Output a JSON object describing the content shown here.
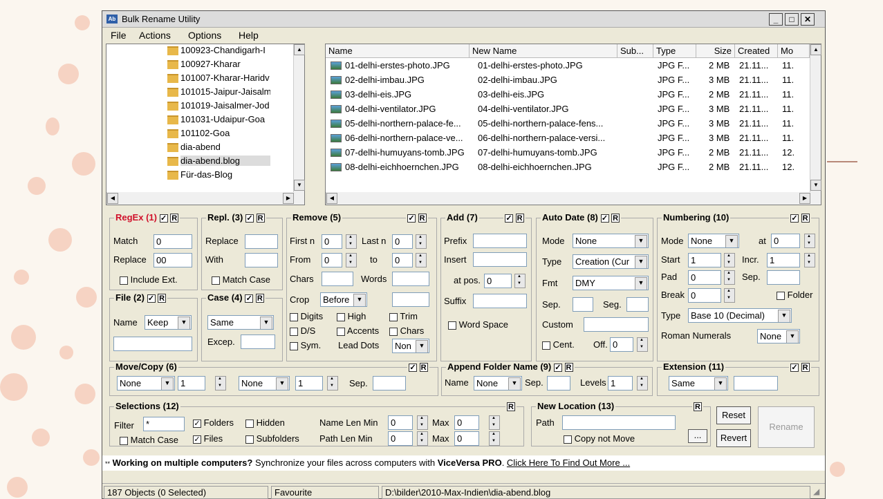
{
  "window": {
    "title": "Bulk Rename Utility",
    "app_icon_text": "Ab"
  },
  "menu": [
    "File",
    "Actions",
    "Options",
    "Help"
  ],
  "tree": [
    "100923-Chandigarh-I",
    "100927-Kharar",
    "101007-Kharar-Haridv",
    "101015-Jaipur-Jaisalm",
    "101019-Jaisalmer-Jod",
    "101031-Udaipur-Goa",
    "101102-Goa",
    "dia-abend",
    "dia-abend.blog",
    "Für-das-Blog"
  ],
  "columns": [
    "Name",
    "New Name",
    "Sub...",
    "Type",
    "Size",
    "Created",
    "Mo"
  ],
  "files": [
    {
      "name": "01-delhi-erstes-photo.JPG",
      "new": "01-delhi-erstes-photo.JPG",
      "type": "JPG F...",
      "size": "2 MB",
      "created": "21.11...",
      "mod": "11."
    },
    {
      "name": "02-delhi-imbau.JPG",
      "new": "02-delhi-imbau.JPG",
      "type": "JPG F...",
      "size": "3 MB",
      "created": "21.11...",
      "mod": "11."
    },
    {
      "name": "03-delhi-eis.JPG",
      "new": "03-delhi-eis.JPG",
      "type": "JPG F...",
      "size": "2 MB",
      "created": "21.11...",
      "mod": "11."
    },
    {
      "name": "04-delhi-ventilator.JPG",
      "new": "04-delhi-ventilator.JPG",
      "type": "JPG F...",
      "size": "3 MB",
      "created": "21.11...",
      "mod": "11."
    },
    {
      "name": "05-delhi-northern-palace-fe...",
      "new": "05-delhi-northern-palace-fens...",
      "type": "JPG F...",
      "size": "3 MB",
      "created": "21.11...",
      "mod": "11."
    },
    {
      "name": "06-delhi-northern-palace-ve...",
      "new": "06-delhi-northern-palace-versi...",
      "type": "JPG F...",
      "size": "3 MB",
      "created": "21.11...",
      "mod": "11."
    },
    {
      "name": "07-delhi-humuyans-tomb.JPG",
      "new": "07-delhi-humuyans-tomb.JPG",
      "type": "JPG F...",
      "size": "2 MB",
      "created": "21.11...",
      "mod": "12."
    },
    {
      "name": "08-delhi-eichhoernchen.JPG",
      "new": "08-delhi-eichhoernchen.JPG",
      "type": "JPG F...",
      "size": "2 MB",
      "created": "21.11...",
      "mod": "12."
    }
  ],
  "regex": {
    "title": "RegEx (1)",
    "r": "R",
    "match_label": "Match",
    "match": "0",
    "replace_label": "Replace",
    "replace": "00",
    "include_ext": "Include Ext."
  },
  "repl": {
    "title": "Repl. (3)",
    "r": "R",
    "replace_label": "Replace",
    "with_label": "With",
    "match_case": "Match Case"
  },
  "file": {
    "title": "File (2)",
    "r": "R",
    "name_label": "Name",
    "name_value": "Keep"
  },
  "case": {
    "title": "Case (4)",
    "r": "R",
    "value": "Same",
    "excep": "Excep."
  },
  "remove": {
    "title": "Remove (5)",
    "r": "R",
    "first_n": "First n",
    "first_val": "0",
    "last_n": "Last n",
    "last_val": "0",
    "from": "From",
    "from_val": "0",
    "to": "to",
    "to_val": "0",
    "chars": "Chars",
    "words": "Words",
    "crop": "Crop",
    "crop_val": "Before",
    "digits": "Digits",
    "high": "High",
    "trim": "Trim",
    "ds": "D/S",
    "accents": "Accents",
    "chars2": "Chars",
    "sym": "Sym.",
    "lead_dots": "Lead Dots",
    "lead_val": "Non"
  },
  "add": {
    "title": "Add (7)",
    "r": "R",
    "prefix": "Prefix",
    "insert": "Insert",
    "at_pos": "at pos.",
    "at_val": "0",
    "suffix": "Suffix",
    "word_space": "Word Space"
  },
  "autodate": {
    "title": "Auto Date (8)",
    "r": "R",
    "mode": "Mode",
    "mode_val": "None",
    "type": "Type",
    "type_val": "Creation (Cur",
    "fmt": "Fmt",
    "fmt_val": "DMY",
    "sep": "Sep.",
    "seg": "Seg.",
    "custom": "Custom",
    "cent": "Cent.",
    "off": "Off.",
    "off_val": "0"
  },
  "numbering": {
    "title": "Numbering (10)",
    "r": "R",
    "mode": "Mode",
    "mode_val": "None",
    "at": "at",
    "at_val": "0",
    "start": "Start",
    "start_val": "1",
    "incr": "Incr.",
    "incr_val": "1",
    "pad": "Pad",
    "pad_val": "0",
    "sep": "Sep.",
    "break": "Break",
    "break_val": "0",
    "folder": "Folder",
    "type": "Type",
    "type_val": "Base 10 (Decimal)",
    "roman": "Roman Numerals",
    "roman_val": "None"
  },
  "movecopy": {
    "title": "Move/Copy (6)",
    "r": "R",
    "sel1": "None",
    "num1": "1",
    "sel2": "None",
    "num2": "1",
    "sep": "Sep."
  },
  "append": {
    "title": "Append Folder Name (9)",
    "r": "R",
    "name": "Name",
    "name_val": "None",
    "sep": "Sep.",
    "levels": "Levels",
    "levels_val": "1"
  },
  "extension": {
    "title": "Extension (11)",
    "r": "R",
    "value": "Same"
  },
  "selections": {
    "title": "Selections (12)",
    "r": "R",
    "filter": "Filter",
    "filter_val": "*",
    "folders": "Folders",
    "hidden": "Hidden",
    "files": "Files",
    "subfolders": "Subfolders",
    "match_case": "Match Case",
    "name_len_min": "Name Len Min",
    "name_min_val": "0",
    "max": "Max",
    "name_max_val": "0",
    "path_len_min": "Path Len Min",
    "path_min_val": "0",
    "path_max_val": "0"
  },
  "newloc": {
    "title": "New Location (13)",
    "r": "R",
    "path": "Path",
    "browse": "...",
    "copy_not_move": "Copy not Move"
  },
  "buttons": {
    "reset": "Reset",
    "revert": "Revert",
    "rename": "Rename"
  },
  "ad": {
    "prefix": "**",
    "bold": "Working on multiple computers?",
    "text": " Synchronize your files across computers with ",
    "brand": "ViceVersa PRO",
    "dot": ". ",
    "link": "Click Here To Find Out More ..."
  },
  "status": {
    "objects": "187 Objects (0 Selected)",
    "favourite": "Favourite",
    "path": "D:\\bilder\\2010-Max-Indien\\dia-abend.blog"
  }
}
